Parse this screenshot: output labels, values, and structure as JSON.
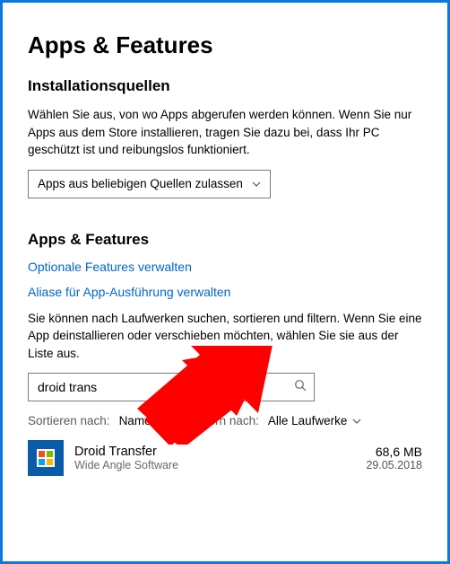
{
  "pageTitle": "Apps & Features",
  "section1": {
    "title": "Installationsquellen",
    "body": "Wählen Sie aus, von wo Apps abgerufen werden können. Wenn Sie nur Apps aus dem Store installieren, tragen Sie dazu bei, dass Ihr PC geschützt ist und reibungslos funktioniert.",
    "dropdown": "Apps aus beliebigen Quellen zulassen"
  },
  "section2": {
    "title": "Apps & Features",
    "link1": "Optionale Features verwalten",
    "link2": "Aliase für App-Ausführung verwalten",
    "body": "Sie können nach Laufwerken suchen, sortieren und filtern. Wenn Sie eine App deinstallieren oder verschieben möchten, wählen Sie sie aus der Liste aus.",
    "searchValue": "droid trans",
    "sortLabel": "Sortieren nach:",
    "sortValue": "Name",
    "filterLabel": "Filtern nach:",
    "filterValue": "Alle Laufwerke"
  },
  "app": {
    "name": "Droid Transfer",
    "publisher": "Wide Angle Software",
    "size": "68,6 MB",
    "date": "29.05.2018"
  }
}
